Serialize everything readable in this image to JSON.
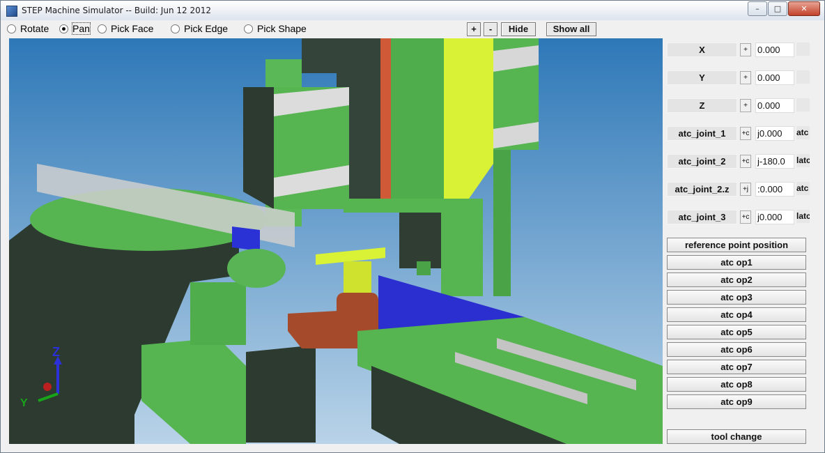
{
  "window": {
    "title": "STEP Machine Simulator -- Build: Jun 12 2012",
    "minimize": "–",
    "maximize": "□",
    "close": "✕"
  },
  "toolbar": {
    "modes": [
      {
        "label": "Rotate",
        "checked": false
      },
      {
        "label": "Pan",
        "checked": true
      },
      {
        "label": "Pick Face",
        "checked": false
      },
      {
        "label": "Pick Edge",
        "checked": false
      },
      {
        "label": "Pick Shape",
        "checked": false
      }
    ],
    "zoom_in": "+",
    "zoom_out": "-",
    "hide": "Hide",
    "show_all": "Show all"
  },
  "triad": {
    "z": "Z",
    "y": "Y"
  },
  "axes": [
    {
      "label": "X",
      "button": "+",
      "value": "0.000",
      "extra": ""
    },
    {
      "label": "Y",
      "button": "+",
      "value": "0.000",
      "extra": ""
    },
    {
      "label": "Z",
      "button": "+",
      "value": "0.000",
      "extra": ""
    },
    {
      "label": "atc_joint_1",
      "button": "+c",
      "value": "j0.000",
      "extra": "atc"
    },
    {
      "label": "atc_joint_2",
      "button": "+c",
      "value": "j-180.0",
      "extra": "latc"
    },
    {
      "label": "atc_joint_2.z",
      "button": "+j",
      "value": ":0.000",
      "extra": "atc"
    },
    {
      "label": "atc_joint_3",
      "button": "+c",
      "value": "j0.000",
      "extra": "latc"
    }
  ],
  "operations": [
    "reference point position",
    "atc op1",
    "atc op2",
    "atc op3",
    "atc op4",
    "atc op5",
    "atc op6",
    "atc op7",
    "atc op8",
    "atc op9"
  ],
  "tool_change": "tool change",
  "colors": {
    "machine_green": "#56b451",
    "machine_dark": "#2b3a2f",
    "table_blue": "#2c2fd0",
    "spindle_yellow": "#d9f235",
    "arm_brown": "#a54b2c",
    "background": "#3c86c6"
  }
}
